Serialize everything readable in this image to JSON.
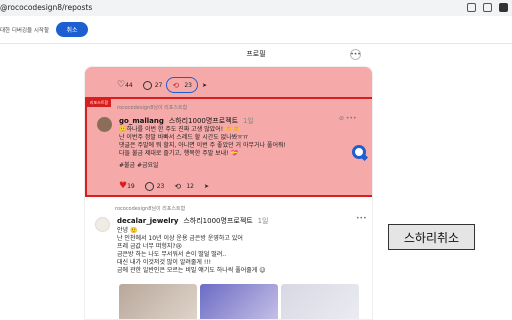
{
  "browser": {
    "url": "@rococodesign8/reposts"
  },
  "toolbar": {
    "hint_text": "대한 디버깅을 시작할",
    "cancel_button": "취소"
  },
  "page_title": "프로필",
  "post1": {
    "likes": "44",
    "comments": "27",
    "reposts": "23"
  },
  "post2": {
    "badge": "리포스트함",
    "repost_note": "rococodesign8님이 리포스트함",
    "username": "go_mallang",
    "subtitle": "스하리1000명프로젝트",
    "time": "1일",
    "lines": [
      "🙂하나를 이번 한 주도 진짜 고생 많았어! 🫶🫶",
      "난 이번주 정말 바빠서 스레드 할 시간도 없나봐ㅠㅠ",
      "댓글은 주말에 뭐 할지, 아니면 이번 주 좋았던 거 아무거나 풀어줘!",
      "다들 불금 제대로 즐기고, 행복한 주말 보내! 💝"
    ],
    "tags": "#불금 #금요일",
    "likes": "19",
    "comments": "23",
    "reposts": "12"
  },
  "post3": {
    "repost_note": "rococodesign8님이 리포스트함",
    "username": "decalar_jewelry",
    "subtitle": "스하리1000명프로젝트",
    "time": "1일",
    "lines": [
      "안녕 🙂",
      "난 인천에서 10년 이상 운용 금은방 운영하고 있어",
      "프레 금값 너무 떠헝지?😢",
      "금은방 하는 나도 무서워서 손이 떨덜 떨려..",
      "대신 내가 이것저것 많이 알려줄게 !!!",
      "금에 관한 일반인은 모르는 비밀 얘기도 하나씩 풀어줄게 😉"
    ]
  },
  "callout": "스하리취소",
  "colors": {
    "accent": "#1d5fd1",
    "highlight": "#f6a9a9",
    "border_red": "#d81e1e"
  }
}
